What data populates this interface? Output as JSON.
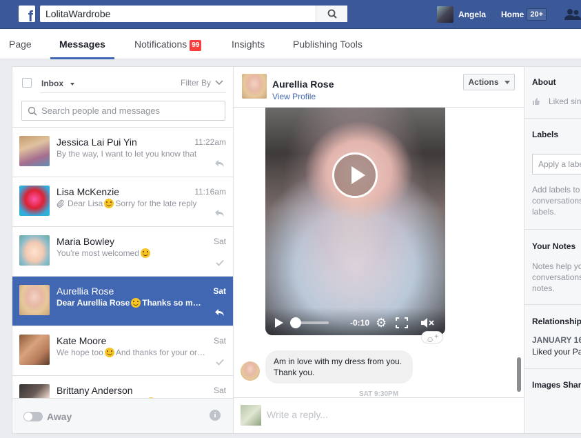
{
  "topbar": {
    "logo_letter": "f",
    "search_value": "LolitaWardrobe",
    "user_name": "Angela",
    "home_label": "Home",
    "home_count": "20+"
  },
  "pagenav": {
    "tabs": [
      {
        "label": "Page"
      },
      {
        "label": "Messages"
      },
      {
        "label": "Notifications",
        "badge": "99"
      },
      {
        "label": "Insights"
      },
      {
        "label": "Publishing Tools"
      }
    ],
    "active": "Messages"
  },
  "inbox": {
    "label": "Inbox",
    "filter_label": "Filter By",
    "search_placeholder": "Search people and messages",
    "threads": [
      {
        "name": "Jessica Lai Pui Yin",
        "time": "11:22am",
        "snippet": "By the way, I want to let you know that",
        "status": "replied"
      },
      {
        "name": "Lisa McKenzie",
        "time": "11:16am",
        "snippet_pre": "Dear Lisa",
        "snippet_post": "Sorry for the late reply",
        "status": "replied"
      },
      {
        "name": "Maria Bowley",
        "time": "Sat",
        "snippet_pre": "You're most welcomed",
        "snippet_post": "",
        "status": "read"
      },
      {
        "name": "Aurellia Rose",
        "time": "Sat",
        "snippet_pre": "Dear Aurellia Rose",
        "snippet_post": "Thanks so much",
        "status": "replied"
      },
      {
        "name": "Kate Moore",
        "time": "Sat",
        "snippet_pre": "We hope too",
        "snippet_post": "And thanks for your order",
        "status": "read"
      },
      {
        "name": "Brittany Anderson",
        "time": "Sat",
        "snippet_pre": "",
        "snippet_post": "",
        "status": "read"
      }
    ],
    "away_label": "Away",
    "info_glyph": "i"
  },
  "chat": {
    "name": "Aurellia Rose",
    "view_profile": "View Profile",
    "actions_label": "Actions",
    "video_time": "-0:10",
    "message": "Am in love with my dress from you. Thank you.",
    "timestamp": "SAT 9:30PM",
    "reply_placeholder": "Write a reply..."
  },
  "sidebar": {
    "about_title": "About",
    "about_text": "Liked since",
    "labels_title": "Labels",
    "labels_placeholder": "Apply a label",
    "labels_help_1": "Add labels to",
    "labels_help_2": "conversations",
    "labels_help_3": "labels.",
    "notes_title": "Your Notes",
    "notes_help_1": "Notes help you",
    "notes_help_2": "conversations",
    "notes_help_3": "notes.",
    "relationship_title": "Relationship",
    "relationship_date": "JANUARY 16",
    "relationship_text": "Liked your Page",
    "images_title": "Images Shared"
  },
  "colors": {
    "brand": "#3b5998",
    "accent": "#4267b2",
    "badge": "#fa3e3e"
  }
}
